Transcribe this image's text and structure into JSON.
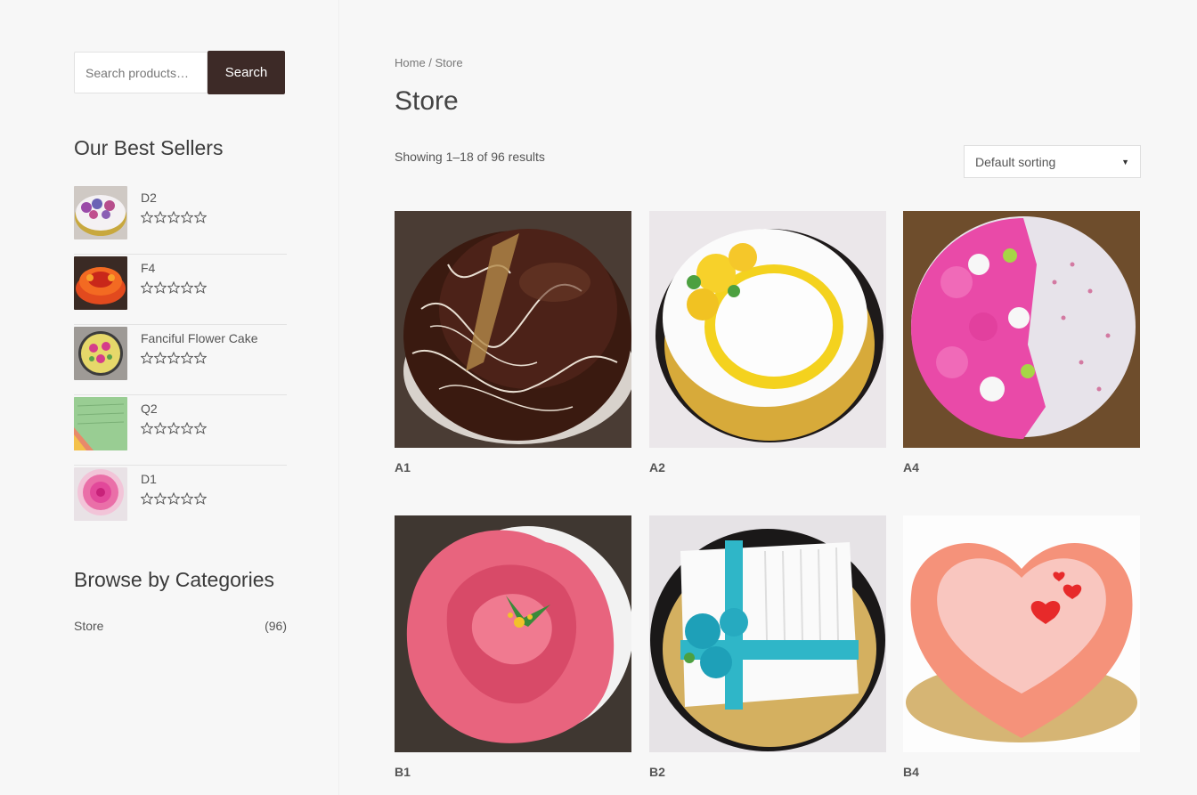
{
  "search": {
    "placeholder": "Search products…",
    "button_label": "Search"
  },
  "sidebar": {
    "best_sellers_title": "Our Best Sellers",
    "best_sellers": [
      {
        "name": "D2",
        "rating": 0
      },
      {
        "name": "F4",
        "rating": 0
      },
      {
        "name": "Fanciful Flower Cake",
        "rating": 0
      },
      {
        "name": "Q2",
        "rating": 0
      },
      {
        "name": "D1",
        "rating": 0
      }
    ],
    "categories_title": "Browse by Categories",
    "categories": [
      {
        "name": "Store",
        "count": "(96)"
      }
    ]
  },
  "main": {
    "breadcrumb": "Home / Store",
    "title": "Store",
    "result_count": "Showing 1–18 of 96 results",
    "sorting_selected": "Default sorting",
    "products": [
      {
        "name": "A1"
      },
      {
        "name": "A2"
      },
      {
        "name": "A4"
      },
      {
        "name": "B1"
      },
      {
        "name": "B2"
      },
      {
        "name": "B4"
      }
    ]
  },
  "colors": {
    "search_button": "#3d2a27",
    "background": "#f7f7f7"
  }
}
